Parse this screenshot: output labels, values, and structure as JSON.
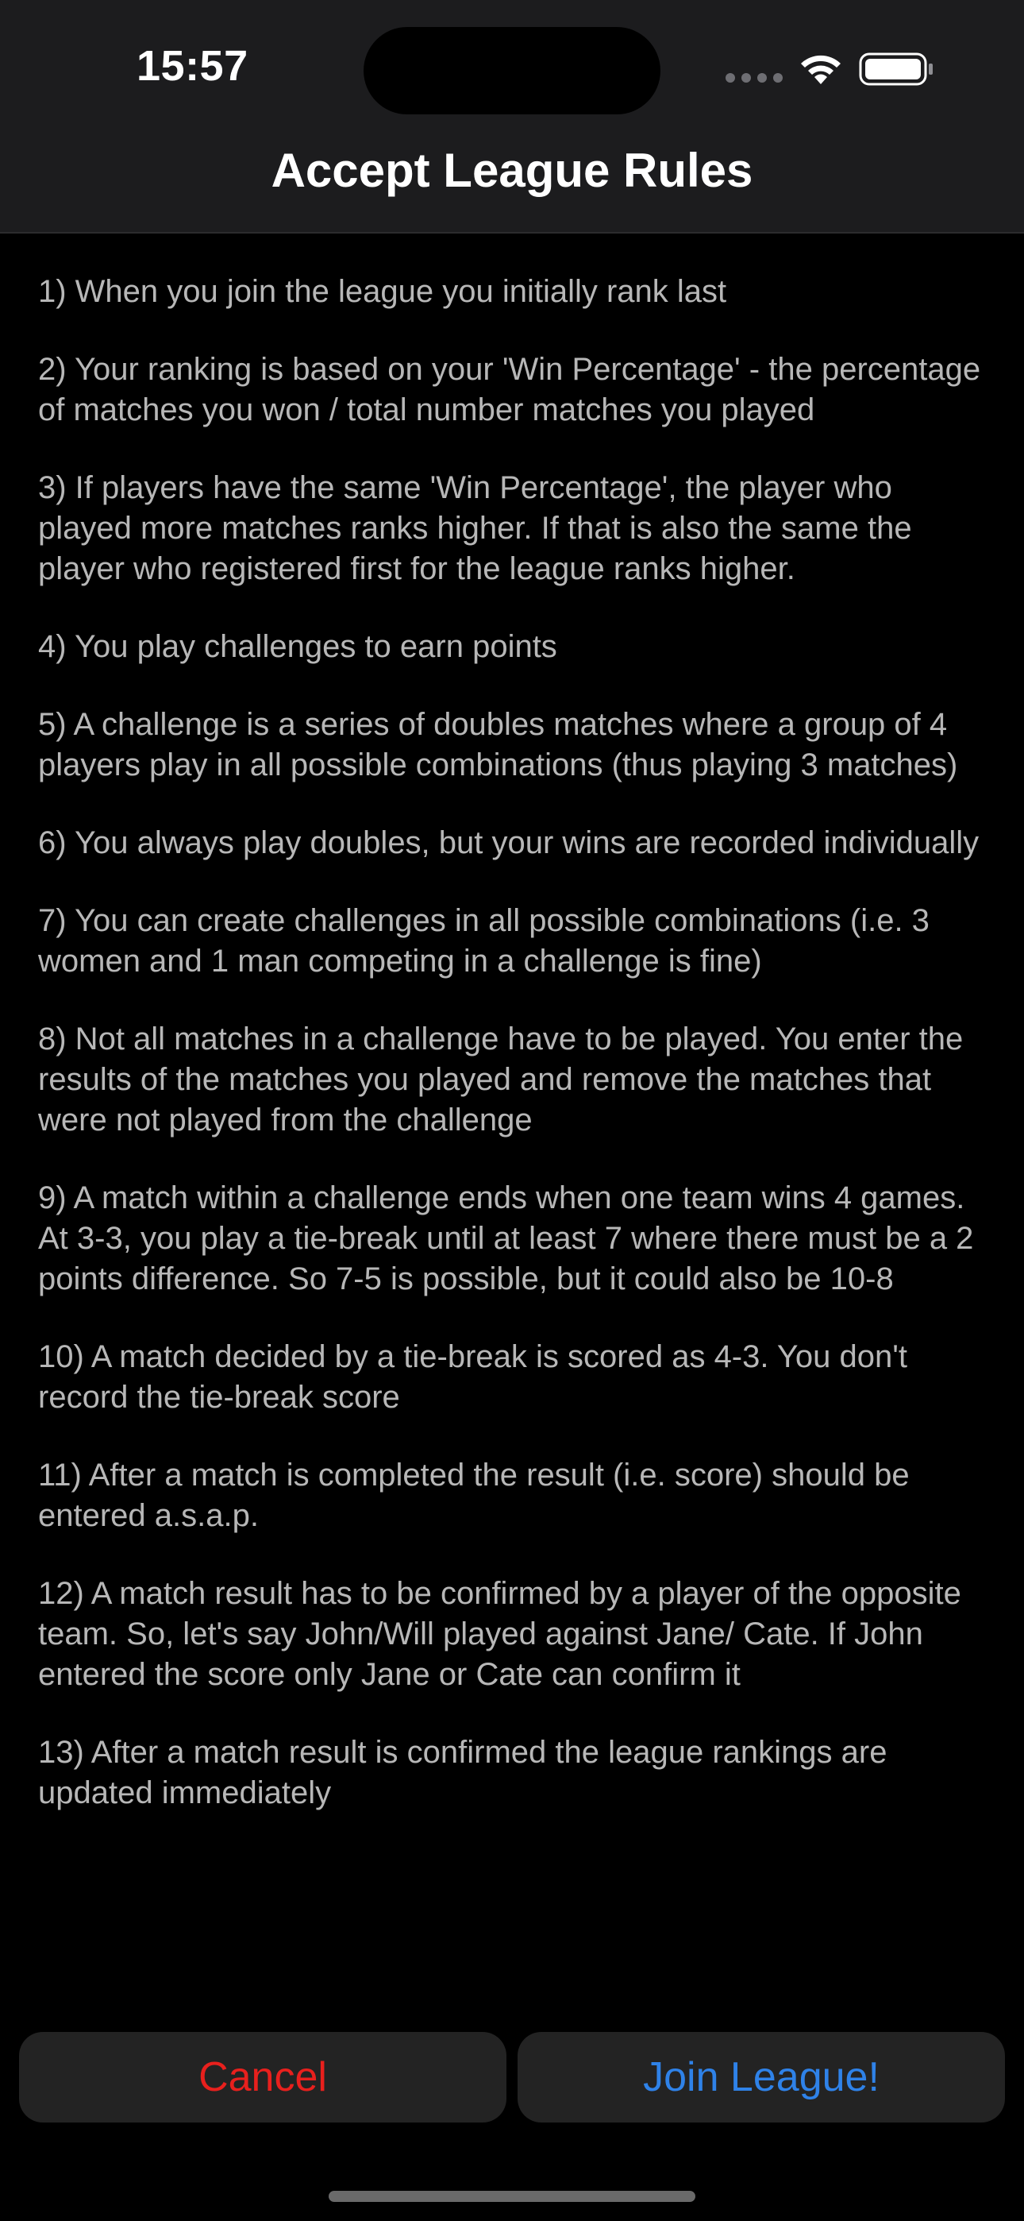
{
  "status_bar": {
    "time": "15:57",
    "icons": [
      "cellular-signal-icon",
      "wifi-icon",
      "battery-icon"
    ]
  },
  "nav": {
    "title": "Accept League Rules"
  },
  "rules": [
    "1) When you join the league you initially rank last",
    "2) Your ranking is based on your 'Win Percentage' - the percentage of matches you won / total number matches you played",
    "3) If players have the same 'Win Percentage', the player who played more matches ranks higher. If that is also the same the player who registered first for the league ranks higher.",
    "4) You play challenges to earn points",
    "5) A challenge is a series of doubles matches where a group of 4 players play in all possible combinations (thus playing 3 matches)",
    "6) You always play doubles, but your wins are recorded individually",
    "7) You can create challenges in all possible combinations (i.e. 3 women and 1 man competing in a challenge is fine)",
    "8) Not all matches in a challenge have to be played. You enter the results of the matches you played and remove the matches that were not played from the challenge",
    "9) A match within a challenge ends when one team wins 4 games. At 3-3, you play a tie-break until at least 7 where there must be a 2 points difference. So 7-5 is possible, but it could also be 10-8",
    "10) A match decided by a tie-break is scored as 4-3. You don't record the tie-break score",
    "11) After a match is completed the result (i.e. score) should be entered a.s.a.p.",
    "12) A match result has to be confirmed by a player of the opposite team. So, let's say John/Will played against Jane/ Cate. If John entered the score only Jane or Cate can confirm it",
    "13) After a match result is confirmed the league rankings are updated immediately"
  ],
  "buttons": {
    "cancel_label": "Cancel",
    "join_label": "Join League!"
  },
  "colors": {
    "cancel": "#e8201d",
    "join": "#2f82e8",
    "background": "#000000",
    "nav_background": "#1c1c1e",
    "rule_text": "#b7b7b7"
  }
}
